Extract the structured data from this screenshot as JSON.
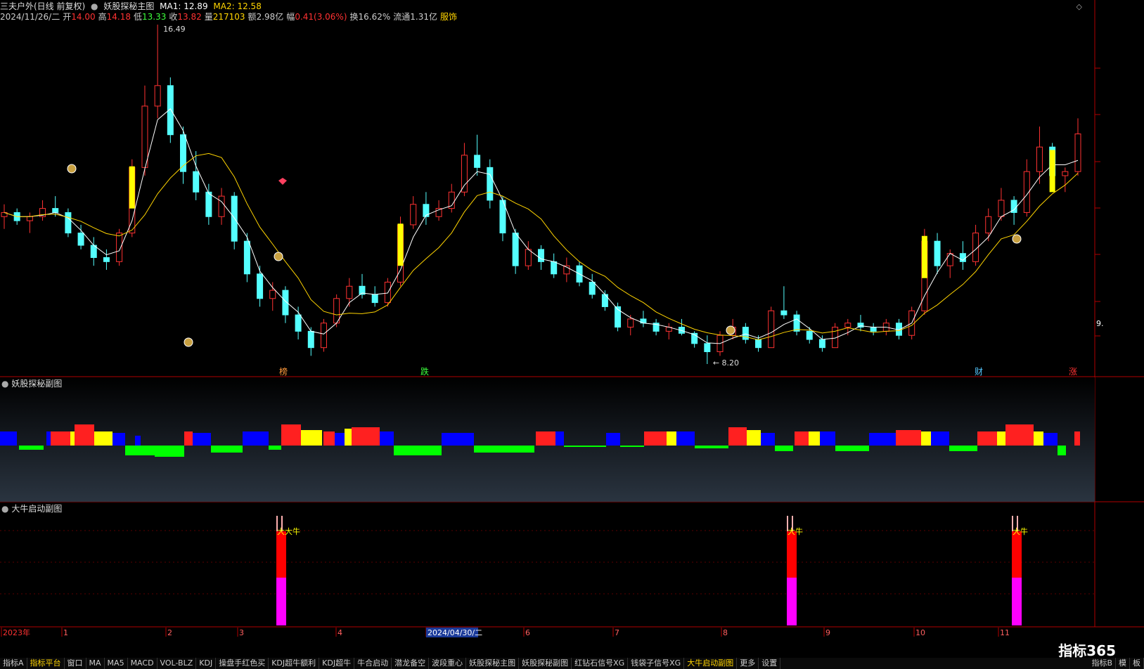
{
  "header": {
    "stock_title": "三夫户外(日线 前复权)",
    "main_indicator": "妖股探秘主图",
    "ma1": "MA1: 12.89",
    "ma2": "MA2: 12.58",
    "date": "2024/11/26/二",
    "open_label": "开",
    "open": "14.00",
    "high_label": "高",
    "high": "14.18",
    "low_label": "低",
    "low": "13.33",
    "close_label": "收",
    "close": "13.82",
    "vol_label": "量",
    "volume": "217103",
    "amount_label": "额",
    "amount": "2.98亿",
    "change_label": "幅",
    "change": "0.41(3.06%)",
    "turnover": "换16.62%",
    "float_cap": "流通1.31亿",
    "sector": "服饰"
  },
  "colors": {
    "up": "#ff3232",
    "down": "#54ffff",
    "ma1": "#ffffff",
    "ma2": "#ffd400",
    "signal_yellow": "#ffff00",
    "hist_red": "#ff2020",
    "hist_blue": "#0000ff",
    "hist_yellow": "#ffff00",
    "hist_green": "#00ff00",
    "bull_red": "#ff0000",
    "bull_magenta": "#ff00ff"
  },
  "price_labels": {
    "high_mark": "16.49",
    "low_mark": "8.20",
    "right_edge_value": "9."
  },
  "event_markers": [
    "榜",
    "跌",
    "财",
    "涨"
  ],
  "sub1": {
    "title": "妖股探秘副图"
  },
  "sub2": {
    "title": "大牛启动副图",
    "signal_labels": [
      "大大牛",
      "大牛",
      "大牛"
    ]
  },
  "timeline": {
    "labels": [
      "2023年",
      "1",
      "2",
      "3",
      "4",
      "2024/04/30/二",
      "6",
      "7",
      "8",
      "9",
      "10",
      "11"
    ]
  },
  "tabs": [
    "指标A",
    "指标平台",
    "窗口",
    "MA",
    "MA5",
    "MACD",
    "VOL-BLZ",
    "KDJ",
    "操盘手红色买",
    "KDJ超牛额利",
    "KDJ超牛",
    "牛合启动",
    "潜龙备空",
    "波段重心",
    "妖股探秘主图",
    "妖股探秘副图",
    "红钻石信号XG",
    "钱袋子信号XG",
    "大牛启动副图",
    "更多",
    "设置"
  ],
  "tabs_right": [
    "指标B",
    "模",
    "板"
  ],
  "watermark": "指标365",
  "chart_data": {
    "type": "candlestick",
    "title": "三夫户外(日线 前复权)",
    "series": [
      {
        "name": "MA1",
        "last": 12.89
      },
      {
        "name": "MA2",
        "last": 12.58
      }
    ],
    "price_range": [
      8.2,
      16.49
    ],
    "candles": [
      [
        11.8,
        12.1,
        11.5,
        11.9
      ],
      [
        11.9,
        12.0,
        11.6,
        11.7
      ],
      [
        11.7,
        11.9,
        11.4,
        11.8
      ],
      [
        11.8,
        12.2,
        11.7,
        12.0
      ],
      [
        12.0,
        12.3,
        11.8,
        11.9
      ],
      [
        11.9,
        12.0,
        11.3,
        11.4
      ],
      [
        11.4,
        11.6,
        11.0,
        11.1
      ],
      [
        11.1,
        11.3,
        10.6,
        10.8
      ],
      [
        10.8,
        11.0,
        10.5,
        10.7
      ],
      [
        10.7,
        11.5,
        10.6,
        11.4
      ],
      [
        11.4,
        13.2,
        11.3,
        13.0
      ],
      [
        13.0,
        15.0,
        12.8,
        14.5
      ],
      [
        14.5,
        16.49,
        14.2,
        15.0
      ],
      [
        15.0,
        15.2,
        13.6,
        13.8
      ],
      [
        13.8,
        14.0,
        12.6,
        12.9
      ],
      [
        12.9,
        13.4,
        12.2,
        12.4
      ],
      [
        12.4,
        12.6,
        11.6,
        11.8
      ],
      [
        11.8,
        12.5,
        11.6,
        12.3
      ],
      [
        12.3,
        12.4,
        11.0,
        11.2
      ],
      [
        11.2,
        11.4,
        10.2,
        10.4
      ],
      [
        10.4,
        10.6,
        9.6,
        9.8
      ],
      [
        9.8,
        10.2,
        9.5,
        10.0
      ],
      [
        10.0,
        10.1,
        9.2,
        9.4
      ],
      [
        9.4,
        9.6,
        8.8,
        9.0
      ],
      [
        9.0,
        9.1,
        8.4,
        8.6
      ],
      [
        8.6,
        9.3,
        8.5,
        9.2
      ],
      [
        9.2,
        9.9,
        9.1,
        9.8
      ],
      [
        9.8,
        10.3,
        9.6,
        10.1
      ],
      [
        10.1,
        10.4,
        9.8,
        9.9
      ],
      [
        9.9,
        10.1,
        9.6,
        9.7
      ],
      [
        9.7,
        10.3,
        9.6,
        10.2
      ],
      [
        10.2,
        11.8,
        10.1,
        11.6
      ],
      [
        11.6,
        12.3,
        11.5,
        12.1
      ],
      [
        12.1,
        12.4,
        11.6,
        11.8
      ],
      [
        11.8,
        12.2,
        11.7,
        12.0
      ],
      [
        12.0,
        12.6,
        11.9,
        12.4
      ],
      [
        12.4,
        13.6,
        12.3,
        13.3
      ],
      [
        13.3,
        13.8,
        12.8,
        13.0
      ],
      [
        13.0,
        13.2,
        12.0,
        12.2
      ],
      [
        12.2,
        12.3,
        11.2,
        11.4
      ],
      [
        11.4,
        11.5,
        10.4,
        10.6
      ],
      [
        10.6,
        11.2,
        10.5,
        11.0
      ],
      [
        11.0,
        11.1,
        10.5,
        10.7
      ],
      [
        10.7,
        10.9,
        10.3,
        10.4
      ],
      [
        10.4,
        10.8,
        10.2,
        10.6
      ],
      [
        10.6,
        10.7,
        10.1,
        10.2
      ],
      [
        10.2,
        10.4,
        9.8,
        9.9
      ],
      [
        9.9,
        10.0,
        9.5,
        9.6
      ],
      [
        9.6,
        9.7,
        9.0,
        9.1
      ],
      [
        9.1,
        9.4,
        8.9,
        9.3
      ],
      [
        9.3,
        9.5,
        9.1,
        9.2
      ],
      [
        9.2,
        9.3,
        8.9,
        9.0
      ],
      [
        9.0,
        9.2,
        8.8,
        9.1
      ],
      [
        9.1,
        9.3,
        8.9,
        8.95
      ],
      [
        8.95,
        9.0,
        8.6,
        8.7
      ],
      [
        8.7,
        8.9,
        8.2,
        8.5
      ],
      [
        8.5,
        9.0,
        8.4,
        8.9
      ],
      [
        8.9,
        9.3,
        8.8,
        9.1
      ],
      [
        9.1,
        9.2,
        8.7,
        8.8
      ],
      [
        8.8,
        8.9,
        8.5,
        8.6
      ],
      [
        8.6,
        9.6,
        8.6,
        9.5
      ],
      [
        9.5,
        10.1,
        9.3,
        9.4
      ],
      [
        9.4,
        9.5,
        8.9,
        9.0
      ],
      [
        9.0,
        9.1,
        8.7,
        8.8
      ],
      [
        8.8,
        8.9,
        8.5,
        8.6
      ],
      [
        8.6,
        9.2,
        8.6,
        9.1
      ],
      [
        9.1,
        9.3,
        8.9,
        9.2
      ],
      [
        9.2,
        9.4,
        9.0,
        9.1
      ],
      [
        9.1,
        9.2,
        8.9,
        9.0
      ],
      [
        9.0,
        9.3,
        8.9,
        9.2
      ],
      [
        9.2,
        9.3,
        8.8,
        8.9
      ],
      [
        8.9,
        9.6,
        8.8,
        9.5
      ],
      [
        9.5,
        11.5,
        9.4,
        11.2
      ],
      [
        11.2,
        11.4,
        10.4,
        10.6
      ],
      [
        10.6,
        11.0,
        10.3,
        10.9
      ],
      [
        10.9,
        11.2,
        10.5,
        10.7
      ],
      [
        10.7,
        11.6,
        10.6,
        11.4
      ],
      [
        11.4,
        12.0,
        11.2,
        11.8
      ],
      [
        11.8,
        12.5,
        11.7,
        12.2
      ],
      [
        12.2,
        12.3,
        11.6,
        11.9
      ],
      [
        11.9,
        13.2,
        11.8,
        12.9
      ],
      [
        12.9,
        14.0,
        12.6,
        13.5
      ],
      [
        13.5,
        13.6,
        12.6,
        12.8
      ],
      [
        12.8,
        13.0,
        12.4,
        12.9
      ],
      [
        12.9,
        14.2,
        12.8,
        13.82
      ]
    ]
  }
}
